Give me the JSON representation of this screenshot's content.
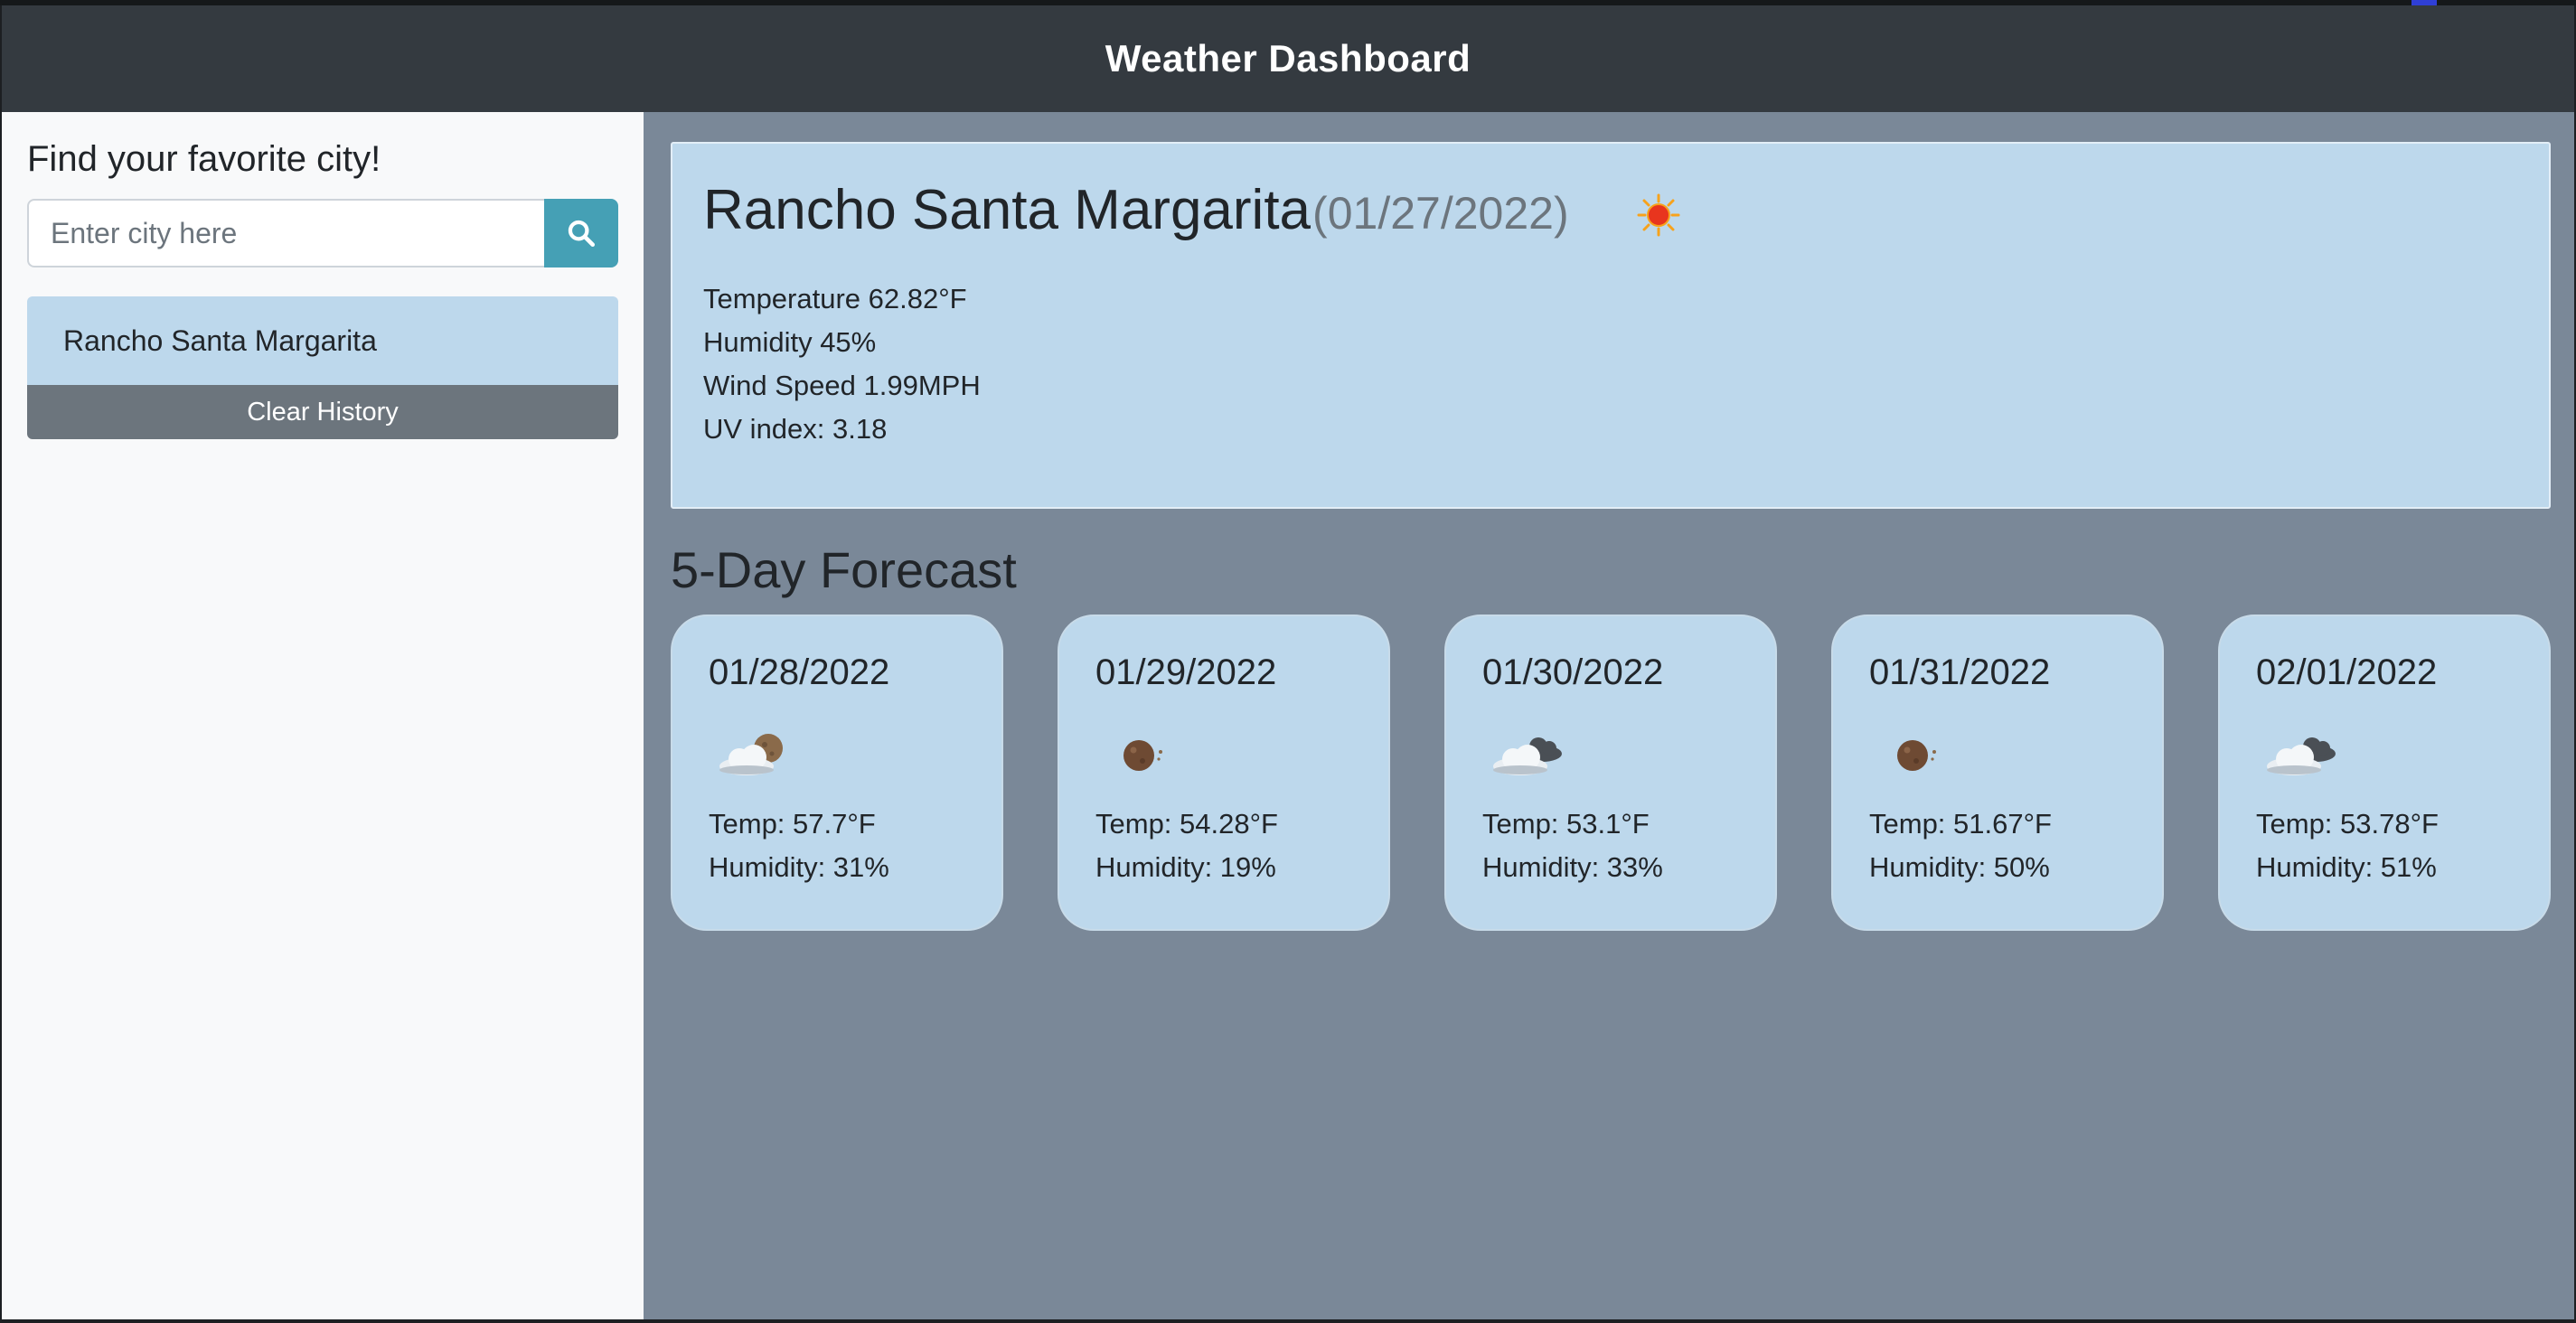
{
  "header": {
    "title": "Weather Dashboard"
  },
  "sidebar": {
    "heading": "Find your favorite city!",
    "search": {
      "placeholder": "Enter city here",
      "value": "",
      "button_icon": "search-icon"
    },
    "history": [
      {
        "label": "Rancho Santa Margarita"
      }
    ],
    "clear_history_label": "Clear History"
  },
  "current": {
    "city": "Rancho Santa Margarita",
    "date": "(01/27/2022)",
    "icon": "clear-sun-icon",
    "temperature": "Temperature 62.82°F",
    "humidity": "Humidity 45%",
    "wind": "Wind Speed 1.99MPH",
    "uv": "UV index: 3.18"
  },
  "forecast": {
    "heading": "5-Day Forecast",
    "days": [
      {
        "date": "01/28/2022",
        "icon": "partly-cloudy-night-icon",
        "temp": "Temp: 57.7°F",
        "humidity": "Humidity: 31%"
      },
      {
        "date": "01/29/2022",
        "icon": "clear-night-icon",
        "temp": "Temp: 54.28°F",
        "humidity": "Humidity: 19%"
      },
      {
        "date": "01/30/2022",
        "icon": "cloudy-icon",
        "temp": "Temp: 53.1°F",
        "humidity": "Humidity: 33%"
      },
      {
        "date": "01/31/2022",
        "icon": "clear-night-icon",
        "temp": "Temp: 51.67°F",
        "humidity": "Humidity: 50%"
      },
      {
        "date": "02/01/2022",
        "icon": "cloudy-icon",
        "temp": "Temp: 53.78°F",
        "humidity": "Humidity: 51%"
      }
    ]
  },
  "colors": {
    "header_bg": "#343a40",
    "main_bg": "#7a8898",
    "card_bg": "#bdd8ec",
    "search_button": "#45a0b5",
    "clear_button": "#6c757d"
  }
}
